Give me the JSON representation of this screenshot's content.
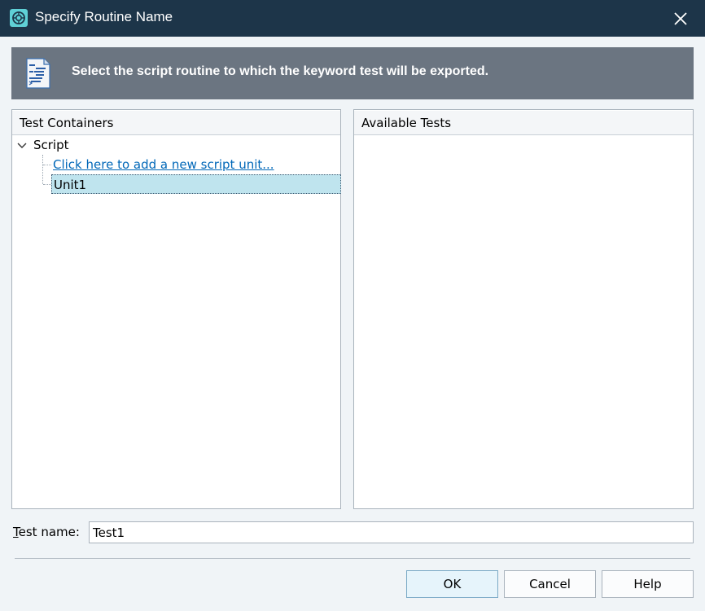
{
  "window": {
    "title": "Specify Routine Name",
    "icon": "testcomplete-app-icon",
    "close_icon": "close-icon"
  },
  "banner": {
    "icon": "script-document-icon",
    "text": "Select the script routine to which the keyword test will be exported."
  },
  "left_panel": {
    "header": "Test Containers",
    "tree": {
      "root_label": "Script",
      "add_link": "Click here to add a new script unit...",
      "items": [
        {
          "label": "Unit1",
          "selected": true
        }
      ]
    }
  },
  "right_panel": {
    "header": "Available Tests"
  },
  "test_name": {
    "label": "Test name:",
    "value": "Test1"
  },
  "buttons": {
    "ok": "OK",
    "cancel": "Cancel",
    "help": "Help"
  },
  "colors": {
    "titlebar": "#1d3549",
    "banner": "#6b7581",
    "selection": "#bfe4ee",
    "link": "#0067b8"
  }
}
